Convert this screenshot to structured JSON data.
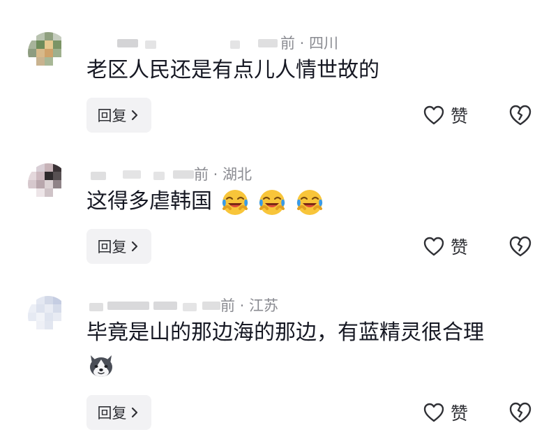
{
  "comments": [
    {
      "meta": "前 · 四川",
      "text": "老区人民还是有点儿人情世故的",
      "reply_label": "回复",
      "like_label": "赞",
      "emoji_count": 0
    },
    {
      "meta": "前 · 湖北",
      "text": "这得多虐韩国",
      "reply_label": "回复",
      "like_label": "赞",
      "emoji_count": 3,
      "emoji_name": "crying-laughing-emoji"
    },
    {
      "meta": "前 · 江苏",
      "text": "毕竟是山的那边海的那边，有蓝精灵很合理",
      "reply_label": "回复",
      "like_label": "赞",
      "emoji_count": 1,
      "emoji_name": "husky-dog-emoji"
    }
  ],
  "icons": {
    "like": "heart-outline-icon",
    "dislike": "broken-heart-icon",
    "reply_chevron": "chevron-right-icon"
  },
  "colors": {
    "text_primary": "#161823",
    "text_secondary": "#8a8b91",
    "button_bg": "#f2f2f4",
    "emoji_yellow": "#f8c53a",
    "emoji_tears": "#3a9be8"
  }
}
